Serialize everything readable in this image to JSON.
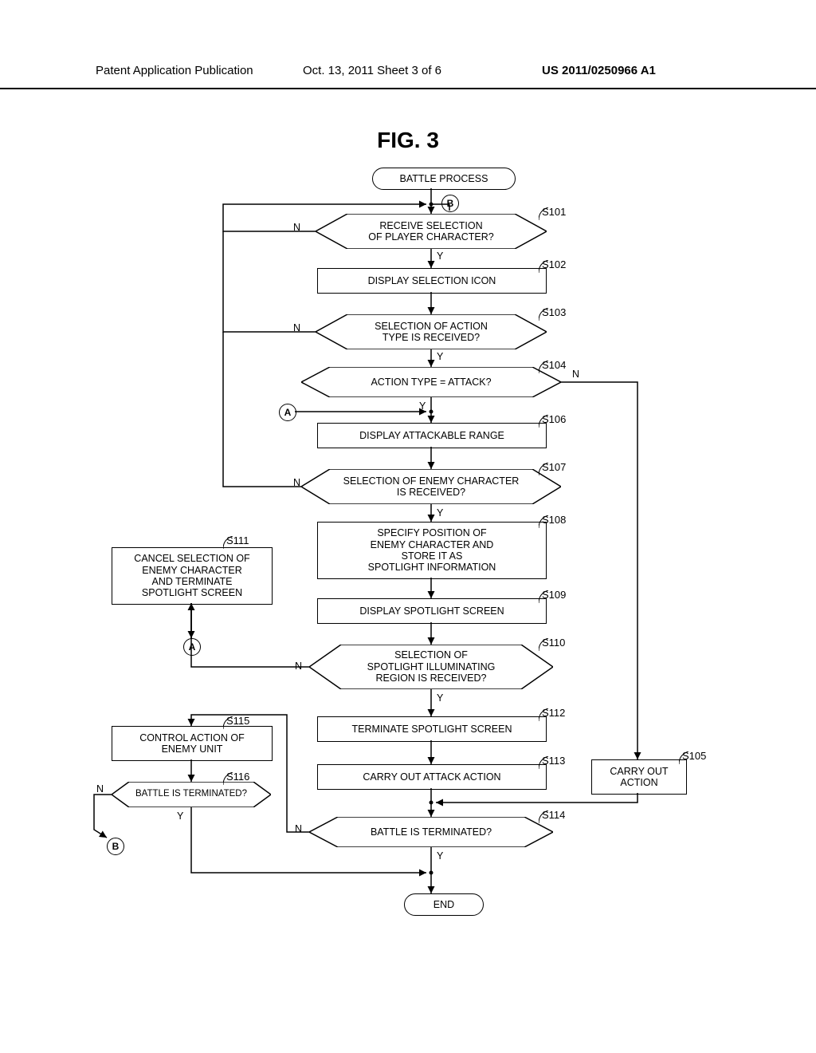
{
  "header": {
    "left": "Patent Application Publication",
    "mid": "Oct. 13, 2011  Sheet 3 of 6",
    "right": "US 2011/0250966 A1"
  },
  "figTitle": "FIG. 3",
  "nodes": {
    "start": "BATTLE PROCESS",
    "s101": "RECEIVE SELECTION\nOF PLAYER CHARACTER?",
    "s102": "DISPLAY SELECTION ICON",
    "s103": "SELECTION OF ACTION\nTYPE IS RECEIVED?",
    "s104": "ACTION TYPE = ATTACK?",
    "s105": "CARRY OUT\nACTION",
    "s106": "DISPLAY ATTACKABLE RANGE",
    "s107": "SELECTION OF ENEMY CHARACTER\nIS RECEIVED?",
    "s108": "SPECIFY POSITION OF\nENEMY CHARACTER AND\nSTORE IT AS\nSPOTLIGHT INFORMATION",
    "s109": "DISPLAY SPOTLIGHT SCREEN",
    "s110": "SELECTION OF\nSPOTLIGHT ILLUMINATING\nREGION IS RECEIVED?",
    "s111": "CANCEL SELECTION OF\nENEMY CHARACTER\nAND TERMINATE\nSPOTLIGHT SCREEN",
    "s112": "TERMINATE SPOTLIGHT SCREEN",
    "s113": "CARRY OUT ATTACK ACTION",
    "s114": "BATTLE IS TERMINATED?",
    "s115": "CONTROL ACTION OF\nENEMY UNIT",
    "s116": "BATTLE IS TERMINATED?",
    "end": "END"
  },
  "stepLabels": {
    "s101": "S101",
    "s102": "S102",
    "s103": "S103",
    "s104": "S104",
    "s105": "S105",
    "s106": "S106",
    "s107": "S107",
    "s108": "S108",
    "s109": "S109",
    "s110": "S110",
    "s111": "S111",
    "s112": "S112",
    "s113": "S113",
    "s114": "S114",
    "s115": "S115",
    "s116": "S116"
  },
  "branch": {
    "yes": "Y",
    "no": "N"
  },
  "connectors": {
    "a": "A",
    "b": "B"
  }
}
